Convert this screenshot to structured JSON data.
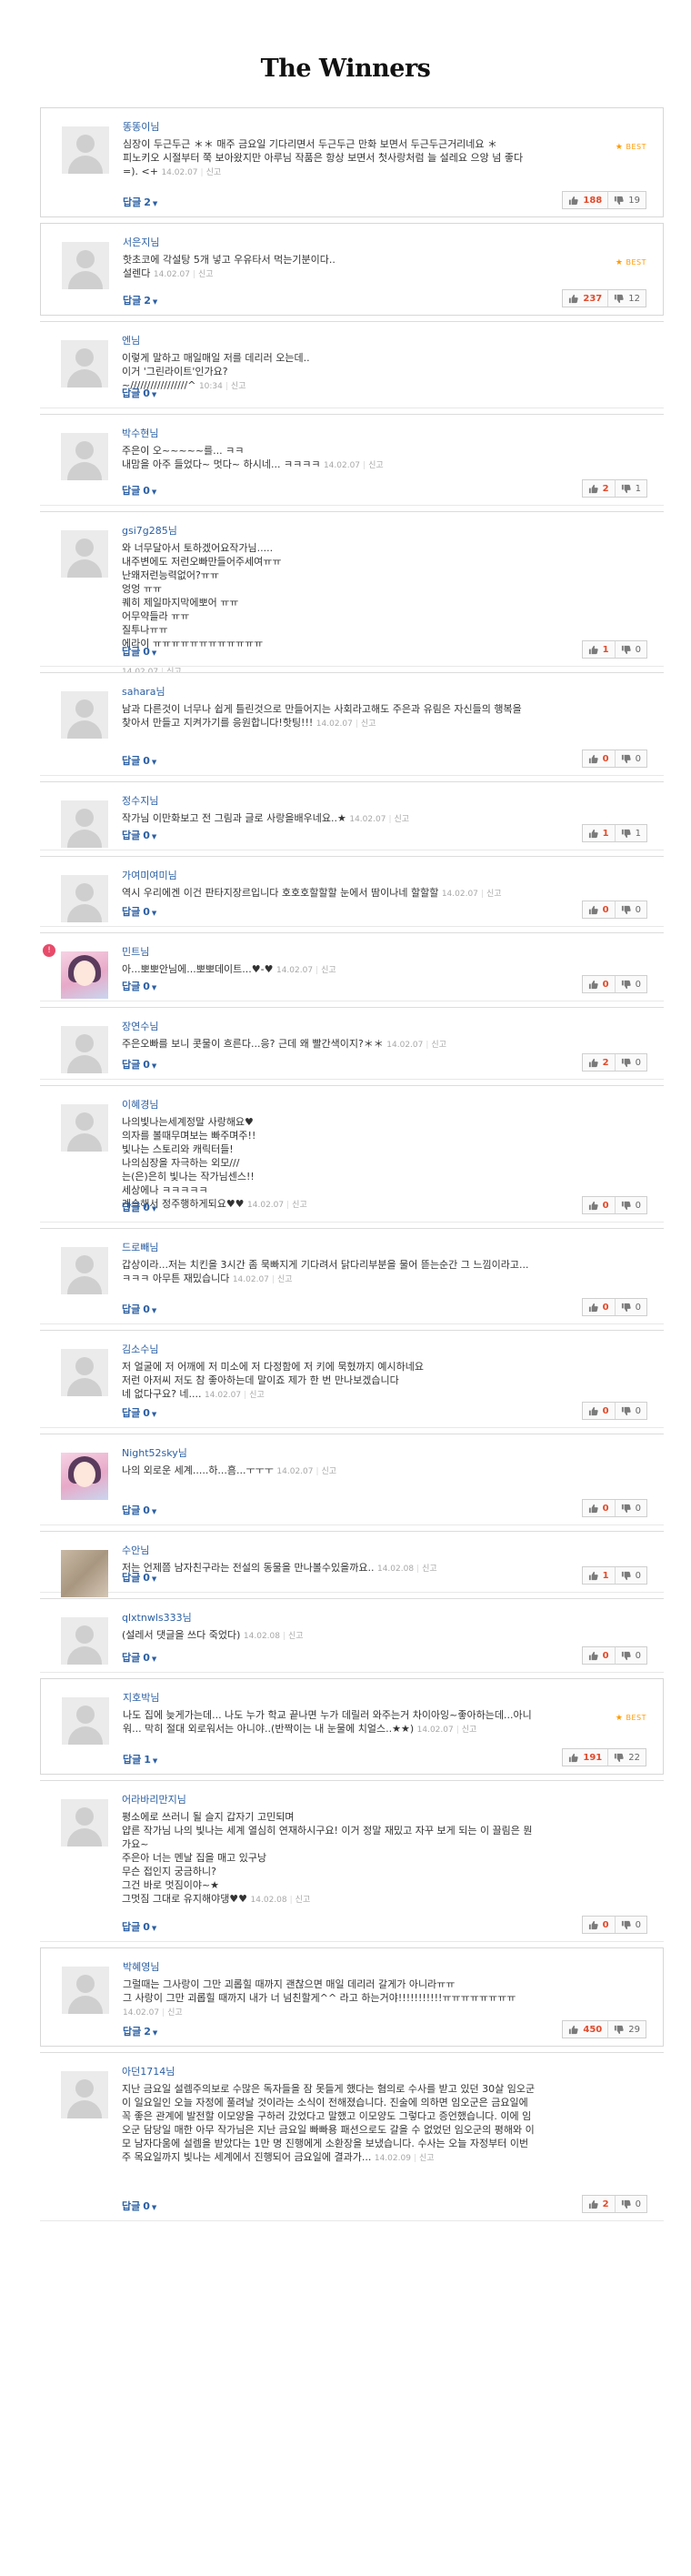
{
  "page": {
    "title": "The Winners"
  },
  "ui": {
    "reply_label": "답글",
    "best_label": "BEST",
    "report_label": "신고"
  },
  "comments": [
    {
      "author": "똥똥이님",
      "lines": [
        "심장이 두근두근 ＊＊ 매주 금요일 기다리면서 두근두근 만화 보면서 두근두근거리네요 ＊",
        "피노키오 시절부터 쭉 보아왔지만 아루님 작품은 항상 보면서 첫사랑처럼 늘 설레요 으앙 넘 좋다"
      ],
      "tail": "=). <+",
      "date": "14.02.07",
      "reply_count": "2",
      "up": "188",
      "down": "19",
      "best": true
    },
    {
      "author": "서은지님",
      "lines": [
        "핫초코에 각설탕 5개 넣고 우유타서 먹는기분이다.."
      ],
      "tail": "설렌다",
      "date": "14.02.07",
      "reply_count": "2",
      "up": "237",
      "down": "12",
      "best": true
    },
    {
      "author": "엔님",
      "lines": [
        "이렇게 말하고 매일매일 저를 데리러 오는데..",
        "이거 '그린라이트'인가요?"
      ],
      "tail": "~/////////////////^",
      "date": "10:34",
      "reply_count": "0",
      "up": "",
      "down": "",
      "best": false
    },
    {
      "author": "박수현님",
      "lines": [
        "주은이 오~~~~~를... ㅋㅋ"
      ],
      "tail": "내맘을 아주 들었다~ 멋다~ 하시네... ㅋㅋㅋㅋ",
      "date": "14.02.07",
      "reply_count": "0",
      "up": "2",
      "down": "1",
      "best": false
    },
    {
      "author": "gsi7g285님",
      "lines": [
        "와 너무달아서 토하겠어요작가님.....",
        "내주변에도 저런오빠만들어주세여ㅠㅠ",
        "난왜저런능력없어?ㅠㅠ",
        "엉엉 ㅠㅠ",
        "퀘히 제일마지막에뽀어 ㅠㅠ",
        "어무약들라 ㅠㅠ",
        "질투나ㅠㅠ",
        "에라이 ㅠㅠㅠㅠㅠㅠㅠㅠㅠㅠㅠㅠ",
        " "
      ],
      "tail": "",
      "date": "14.02.07",
      "reply_count": "0",
      "up": "1",
      "down": "0",
      "best": false
    },
    {
      "author": "sahara님",
      "lines": [
        "남과 다른것이 너무나 쉽게 틀린것으로 만들어지는 사회라고해도 주은과 유림은 자신들의 행복을"
      ],
      "tail": "찾아서 만들고 지켜가기를 응원합니다!핫팅!!!",
      "date": "14.02.07",
      "reply_count": "0",
      "up": "0",
      "down": "0",
      "best": false
    },
    {
      "author": "정수지님",
      "lines": [],
      "tail": "작가님 이만화보고 전 그림과 글로 사랑을배우네요..★",
      "date": "14.02.07",
      "reply_count": "0",
      "up": "1",
      "down": "1",
      "best": false
    },
    {
      "author": "가여미여미님",
      "lines": [],
      "tail": "역시 우리에겐 이건 판타지장르입니다 호호호할할할 눈에서 땀이나네 할할할",
      "date": "14.02.07",
      "reply_count": "0",
      "up": "0",
      "down": "0",
      "best": false
    },
    {
      "author": "민트님",
      "lines": [],
      "tail": "아...뽀뽀안님에...뽀뽀데이트...♥-♥",
      "date": "14.02.07",
      "reply_count": "0",
      "up": "0",
      "down": "0",
      "best": false
    },
    {
      "author": "장연수님",
      "lines": [],
      "tail": "주은오빠를 보니 콧물이 흐른다...응? 근데 왜 빨간색이지?＊＊",
      "date": "14.02.07",
      "reply_count": "0",
      "up": "2",
      "down": "0",
      "best": false
    },
    {
      "author": "이혜경님",
      "lines": [
        "나의빛나는세계정말 사랑해요♥",
        "의자를 볼때무며보는 빠주며주!!",
        "빛나는 스토리와 캐릭터들!",
        "나의심장을 자극하는 외모///",
        "는(은)은히 빛나는 작가님센스!!",
        "세상에나 ㅋㅋㅋㅋㅋ"
      ],
      "tail": "계속해서 정주행하게되요♥♥",
      "date": "14.02.07",
      "reply_count": "0",
      "up": "0",
      "down": "0",
      "best": false
    },
    {
      "author": "드로빼님",
      "lines": [
        "갑상이라...저는 치킨을 3시간 좀 묵빠지게 기다려서 닭다리부분을 물어 뜯는순간 그 느낌이라고..."
      ],
      "tail": "ㅋㅋㅋ 아무튼 재밌습니다",
      "date": "14.02.07",
      "reply_count": "0",
      "up": "0",
      "down": "0",
      "best": false
    },
    {
      "author": "김소수님",
      "lines": [
        "저 얼굴에 저 어깨에 저 미소에 저 다정함에 저 키에 묵혔까지 예시하네요",
        "저런 아저씨 저도 참 좋아하는데 말이죠 제가 한 번 만나보겠습니다"
      ],
      "tail": "네 없다구요? 네....",
      "date": "14.02.07",
      "reply_count": "0",
      "up": "0",
      "down": "0",
      "best": false
    },
    {
      "author": "Night52sky님",
      "lines": [],
      "tail": "나의 외로운 세계.....하...흠...ㅜㅜㅜ",
      "date": "14.02.07",
      "reply_count": "0",
      "up": "0",
      "down": "0",
      "best": false
    },
    {
      "author": "수안님",
      "lines": [],
      "tail": "저는 언제쯤 남자친구라는 전설의 동물을 만나볼수있을까요..",
      "date": "14.02.08",
      "reply_count": "0",
      "up": "1",
      "down": "0",
      "best": false
    },
    {
      "author": "qlxtnwls333님",
      "lines": [],
      "tail": "(설레서 댓글을 쓰다 죽었다)",
      "date": "14.02.08",
      "reply_count": "0",
      "up": "0",
      "down": "0",
      "best": false
    },
    {
      "author": "지호박님",
      "lines": [
        "나도 집에 늦게가는데... 나도 누가 학교 끝나면 누가 데릴러 와주는거 차이아잉~좋아하는데...아니"
      ],
      "tail": "워... 막히 절대 외로워서는 아니야..(반짝이는 내 눈물에 치얼스..★★)",
      "date": "14.02.07",
      "reply_count": "1",
      "up": "191",
      "down": "22",
      "best": true
    },
    {
      "author": "어라바리만지님",
      "lines": [
        "평소에로 쓰러니 될 슬지 갑자기 고민되며",
        "얍른 작가님 나의 빛나는 세계 열심히 연재하시구요! 이거 정말 재밌고 자꾸 보게 되는 이 끌림은 뭔",
        "가요~",
        "주은아 너는 멘날 집을 매고 있구낭",
        "무슨 접인지 궁금하니?",
        "그건 바로 멋짐이야~★"
      ],
      "tail": "그멋짐 그대로 유지해야댕♥♥",
      "date": "14.02.08",
      "reply_count": "0",
      "up": "0",
      "down": "0",
      "best": false
    },
    {
      "author": "박혜영님",
      "lines": [
        "그럴때는 그사랑이 그만 괴롭힐 때까지 괜찮으면 매일 데리러 갈게가 아니라ㅠㅠ",
        "그 사랑이 그만 괴롭힐 때까지 내가 너 넘친할게^^ 라고 하는거야!!!!!!!!!!!ㅠㅠㅠㅠㅠㅠㅠㅠ"
      ],
      "tail": "",
      "date": "14.02.07",
      "reply_count": "2",
      "up": "450",
      "down": "29",
      "best": true
    },
    {
      "author": "아던1714님",
      "lines": [
        "지난 금요일 설렘주의보로 수많은 독자들을 잠 못들게 했다는 혐의로 수사를 받고 있던 30살 임오군",
        "이 일요일인 오늘 자정에 풀려날 것이라는 소식이 전해졌습니다. 진술에 의하면 임오군은 금요일에",
        "꼭 좋은 관계에 발전할 이모양을 구하러 갔었다고 말했고 이모양도 그렇다고 증언했습니다. 이에 임",
        "오군 담당일 매한 아무 작가님은 지난 금요일 빠빠용 패션으로도 갈을 수 없었던 임오군의 평해와 이",
        "모 남자다움에 설렘을 받았다는 1만 명 진행에게 소환장을 보냈습니다. 수사는 오늘 자정부터 이번"
      ],
      "tail": "주 목요일까지 빛나는 세계에서 진행되어 금요일에 결과가...",
      "date": "14.02.09",
      "reply_count": "0",
      "up": "2",
      "down": "0",
      "best": false
    }
  ]
}
